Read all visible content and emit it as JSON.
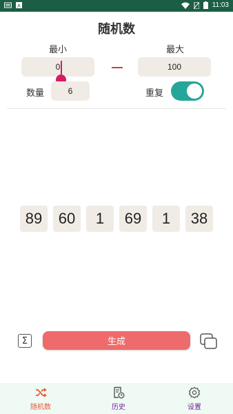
{
  "status_bar": {
    "time": "11:03"
  },
  "app": {
    "title": "随机数"
  },
  "range": {
    "min_label": "最小",
    "max_label": "最大",
    "min_value": "0",
    "max_value": "100"
  },
  "options": {
    "count_label": "数量",
    "count_value": "6",
    "repeat_label": "重复",
    "repeat_enabled": true
  },
  "results": [
    "89",
    "60",
    "1",
    "69",
    "1",
    "38"
  ],
  "actions": {
    "generate_label": "生成",
    "sum_symbol": "Σ"
  },
  "bottom_nav": [
    {
      "label": "随机数",
      "icon": "shuffle-icon",
      "active": true
    },
    {
      "label": "历史",
      "icon": "history-icon",
      "active": false
    },
    {
      "label": "设置",
      "icon": "gear-icon",
      "active": false
    }
  ],
  "colors": {
    "status_bar": "#1b5e45",
    "accent_active": "#e85a3a",
    "nav_inactive": "#7b1fa2",
    "toggle_on": "#26a69a",
    "generate_button": "#ef6b6b",
    "field_bg": "#f0ebe5"
  }
}
